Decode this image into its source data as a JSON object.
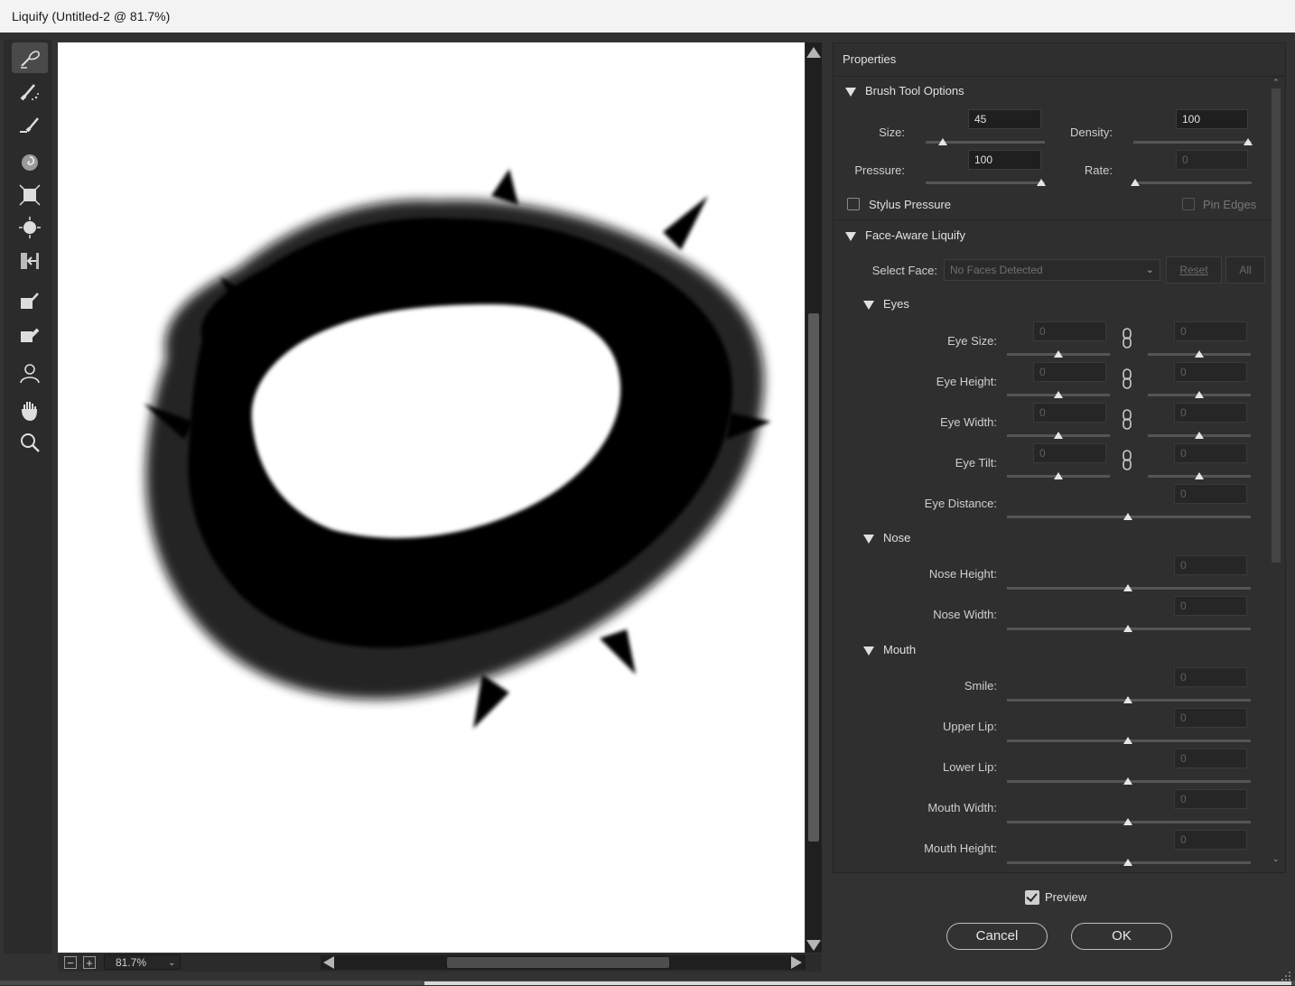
{
  "window": {
    "title": "Liquify (Untitled-2 @ 81.7%)"
  },
  "tools": [
    {
      "name": "forward-warp-tool-icon",
      "active": true
    },
    {
      "name": "reconstruct-tool-icon"
    },
    {
      "name": "smooth-tool-icon"
    },
    {
      "name": "twirl-clockwise-tool-icon"
    },
    {
      "name": "pucker-tool-icon"
    },
    {
      "name": "bloat-tool-icon"
    },
    {
      "name": "push-left-tool-icon"
    },
    {
      "name": "freeze-mask-tool-icon"
    },
    {
      "name": "thaw-mask-tool-icon"
    },
    {
      "name": "face-tool-icon"
    },
    {
      "name": "hand-tool-icon"
    },
    {
      "name": "zoom-tool-icon"
    }
  ],
  "canvas": {
    "zoom": "81.7%",
    "zoom_out": "−",
    "zoom_in": "+"
  },
  "properties": {
    "title": "Properties",
    "brush": {
      "header": "Brush Tool Options",
      "size_label": "Size:",
      "size": "45",
      "size_fraction": 0.05,
      "density_label": "Density:",
      "density": "100",
      "density_fraction": 1.0,
      "pressure_label": "Pressure:",
      "pressure": "100",
      "pressure_fraction": 1.0,
      "rate_label": "Rate:",
      "rate": "0",
      "rate_fraction": 0.0,
      "stylus_label": "Stylus Pressure",
      "pin_edges_label": "Pin Edges"
    },
    "face": {
      "header": "Face-Aware Liquify",
      "select_face_label": "Select Face:",
      "select_face_value": "No Faces Detected",
      "reset": "Reset",
      "all": "All",
      "eyes_header": "Eyes",
      "eyes": [
        {
          "label": "Eye Size:",
          "left": "0",
          "right": "0"
        },
        {
          "label": "Eye Height:",
          "left": "0",
          "right": "0"
        },
        {
          "label": "Eye Width:",
          "left": "0",
          "right": "0"
        },
        {
          "label": "Eye Tilt:",
          "left": "0",
          "right": "0"
        }
      ],
      "eye_distance_label": "Eye Distance:",
      "eye_distance": "0",
      "nose_header": "Nose",
      "nose": [
        {
          "label": "Nose Height:",
          "value": "0"
        },
        {
          "label": "Nose Width:",
          "value": "0"
        }
      ],
      "mouth_header": "Mouth",
      "mouth": [
        {
          "label": "Smile:",
          "value": "0"
        },
        {
          "label": "Upper Lip:",
          "value": "0"
        },
        {
          "label": "Lower Lip:",
          "value": "0"
        },
        {
          "label": "Mouth Width:",
          "value": "0"
        },
        {
          "label": "Mouth Height:",
          "value": "0"
        }
      ]
    }
  },
  "footer": {
    "preview_label": "Preview",
    "preview_checked": true,
    "cancel": "Cancel",
    "ok": "OK"
  }
}
